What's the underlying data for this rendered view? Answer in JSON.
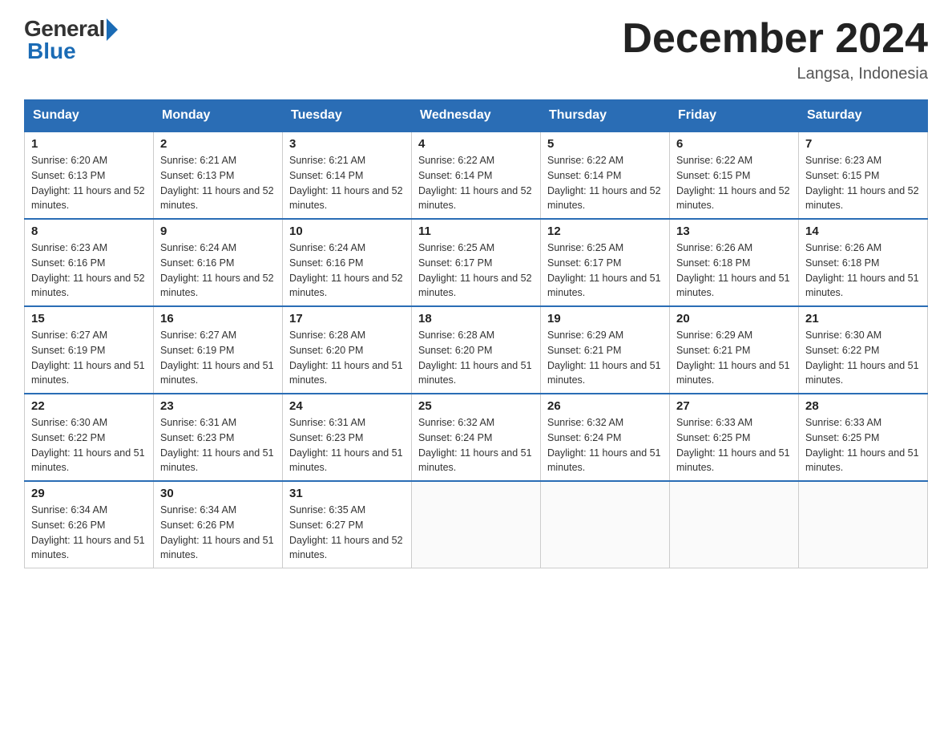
{
  "logo": {
    "general": "General",
    "blue": "Blue"
  },
  "header": {
    "month_title": "December 2024",
    "location": "Langsa, Indonesia"
  },
  "days_of_week": [
    "Sunday",
    "Monday",
    "Tuesday",
    "Wednesday",
    "Thursday",
    "Friday",
    "Saturday"
  ],
  "weeks": [
    [
      {
        "day": "1",
        "sunrise": "6:20 AM",
        "sunset": "6:13 PM",
        "daylight": "11 hours and 52 minutes."
      },
      {
        "day": "2",
        "sunrise": "6:21 AM",
        "sunset": "6:13 PM",
        "daylight": "11 hours and 52 minutes."
      },
      {
        "day": "3",
        "sunrise": "6:21 AM",
        "sunset": "6:14 PM",
        "daylight": "11 hours and 52 minutes."
      },
      {
        "day": "4",
        "sunrise": "6:22 AM",
        "sunset": "6:14 PM",
        "daylight": "11 hours and 52 minutes."
      },
      {
        "day": "5",
        "sunrise": "6:22 AM",
        "sunset": "6:14 PM",
        "daylight": "11 hours and 52 minutes."
      },
      {
        "day": "6",
        "sunrise": "6:22 AM",
        "sunset": "6:15 PM",
        "daylight": "11 hours and 52 minutes."
      },
      {
        "day": "7",
        "sunrise": "6:23 AM",
        "sunset": "6:15 PM",
        "daylight": "11 hours and 52 minutes."
      }
    ],
    [
      {
        "day": "8",
        "sunrise": "6:23 AM",
        "sunset": "6:16 PM",
        "daylight": "11 hours and 52 minutes."
      },
      {
        "day": "9",
        "sunrise": "6:24 AM",
        "sunset": "6:16 PM",
        "daylight": "11 hours and 52 minutes."
      },
      {
        "day": "10",
        "sunrise": "6:24 AM",
        "sunset": "6:16 PM",
        "daylight": "11 hours and 52 minutes."
      },
      {
        "day": "11",
        "sunrise": "6:25 AM",
        "sunset": "6:17 PM",
        "daylight": "11 hours and 52 minutes."
      },
      {
        "day": "12",
        "sunrise": "6:25 AM",
        "sunset": "6:17 PM",
        "daylight": "11 hours and 51 minutes."
      },
      {
        "day": "13",
        "sunrise": "6:26 AM",
        "sunset": "6:18 PM",
        "daylight": "11 hours and 51 minutes."
      },
      {
        "day": "14",
        "sunrise": "6:26 AM",
        "sunset": "6:18 PM",
        "daylight": "11 hours and 51 minutes."
      }
    ],
    [
      {
        "day": "15",
        "sunrise": "6:27 AM",
        "sunset": "6:19 PM",
        "daylight": "11 hours and 51 minutes."
      },
      {
        "day": "16",
        "sunrise": "6:27 AM",
        "sunset": "6:19 PM",
        "daylight": "11 hours and 51 minutes."
      },
      {
        "day": "17",
        "sunrise": "6:28 AM",
        "sunset": "6:20 PM",
        "daylight": "11 hours and 51 minutes."
      },
      {
        "day": "18",
        "sunrise": "6:28 AM",
        "sunset": "6:20 PM",
        "daylight": "11 hours and 51 minutes."
      },
      {
        "day": "19",
        "sunrise": "6:29 AM",
        "sunset": "6:21 PM",
        "daylight": "11 hours and 51 minutes."
      },
      {
        "day": "20",
        "sunrise": "6:29 AM",
        "sunset": "6:21 PM",
        "daylight": "11 hours and 51 minutes."
      },
      {
        "day": "21",
        "sunrise": "6:30 AM",
        "sunset": "6:22 PM",
        "daylight": "11 hours and 51 minutes."
      }
    ],
    [
      {
        "day": "22",
        "sunrise": "6:30 AM",
        "sunset": "6:22 PM",
        "daylight": "11 hours and 51 minutes."
      },
      {
        "day": "23",
        "sunrise": "6:31 AM",
        "sunset": "6:23 PM",
        "daylight": "11 hours and 51 minutes."
      },
      {
        "day": "24",
        "sunrise": "6:31 AM",
        "sunset": "6:23 PM",
        "daylight": "11 hours and 51 minutes."
      },
      {
        "day": "25",
        "sunrise": "6:32 AM",
        "sunset": "6:24 PM",
        "daylight": "11 hours and 51 minutes."
      },
      {
        "day": "26",
        "sunrise": "6:32 AM",
        "sunset": "6:24 PM",
        "daylight": "11 hours and 51 minutes."
      },
      {
        "day": "27",
        "sunrise": "6:33 AM",
        "sunset": "6:25 PM",
        "daylight": "11 hours and 51 minutes."
      },
      {
        "day": "28",
        "sunrise": "6:33 AM",
        "sunset": "6:25 PM",
        "daylight": "11 hours and 51 minutes."
      }
    ],
    [
      {
        "day": "29",
        "sunrise": "6:34 AM",
        "sunset": "6:26 PM",
        "daylight": "11 hours and 51 minutes."
      },
      {
        "day": "30",
        "sunrise": "6:34 AM",
        "sunset": "6:26 PM",
        "daylight": "11 hours and 51 minutes."
      },
      {
        "day": "31",
        "sunrise": "6:35 AM",
        "sunset": "6:27 PM",
        "daylight": "11 hours and 52 minutes."
      },
      null,
      null,
      null,
      null
    ]
  ]
}
